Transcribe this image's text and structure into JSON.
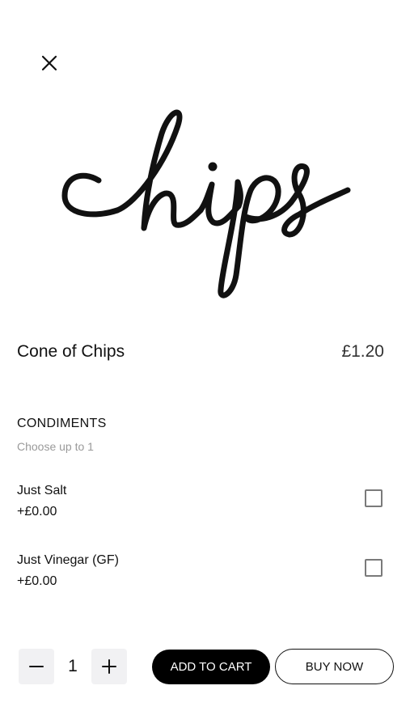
{
  "header": {
    "close_icon": "close-icon"
  },
  "hero": {
    "image_text": "chips"
  },
  "product": {
    "title": "Cone of Chips",
    "price": "£1.20"
  },
  "condiments": {
    "title": "CONDIMENTS",
    "subtitle": "Choose up to 1",
    "options": [
      {
        "name": "Just Salt",
        "price": "+£0.00",
        "checked": false
      },
      {
        "name": "Just Vinegar (GF)",
        "price": "+£0.00",
        "checked": false
      }
    ]
  },
  "footer": {
    "minus_icon": "minus-icon",
    "plus_icon": "plus-icon",
    "quantity": "1",
    "add_to_cart_label": "ADD TO CART",
    "buy_now_label": "BUY NOW"
  }
}
